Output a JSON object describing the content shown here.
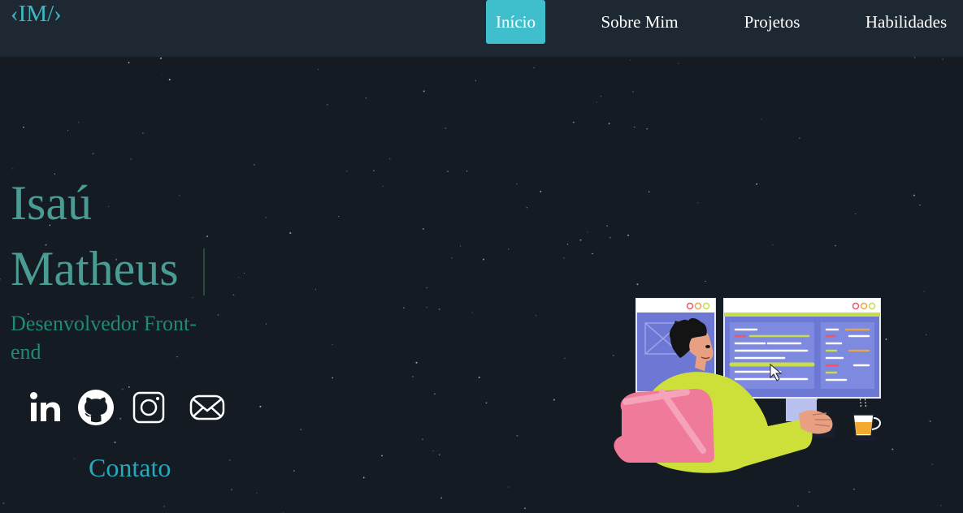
{
  "nav": {
    "logo": "‹IM/›",
    "items": [
      {
        "label": "Início",
        "active": true
      },
      {
        "label": "Sobre Mim",
        "active": false
      },
      {
        "label": "Projetos",
        "active": false
      },
      {
        "label": "Habilidades",
        "active": false
      }
    ]
  },
  "hero": {
    "first_name": "Isaú",
    "last_name": "Matheus",
    "subtitle": "Desenvolvedor Front-end",
    "contact_label": "Contato"
  },
  "social_icons": [
    "linkedin-icon",
    "github-icon",
    "instagram-icon",
    "email-icon"
  ],
  "colors": {
    "background": "#141b22",
    "navbar": "#1e2833",
    "accent": "#3fbfcb",
    "name": "#4a9b94",
    "subtitle": "#1f8a78",
    "contact": "#26a9bc"
  }
}
